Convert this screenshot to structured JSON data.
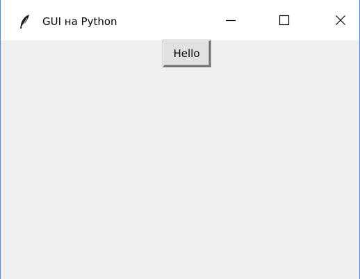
{
  "window": {
    "title": "GUI на Python",
    "icon": "feather-icon",
    "controls": {
      "minimize_icon": "minimize-icon",
      "maximize_icon": "maximize-icon",
      "close_icon": "close-icon"
    }
  },
  "content": {
    "button_label": "Hello"
  },
  "colors": {
    "window_background": "#f0f0f0",
    "titlebar_background": "#ffffff",
    "window_border": "#4a8ad8",
    "button_face": "#e1e1e1"
  }
}
